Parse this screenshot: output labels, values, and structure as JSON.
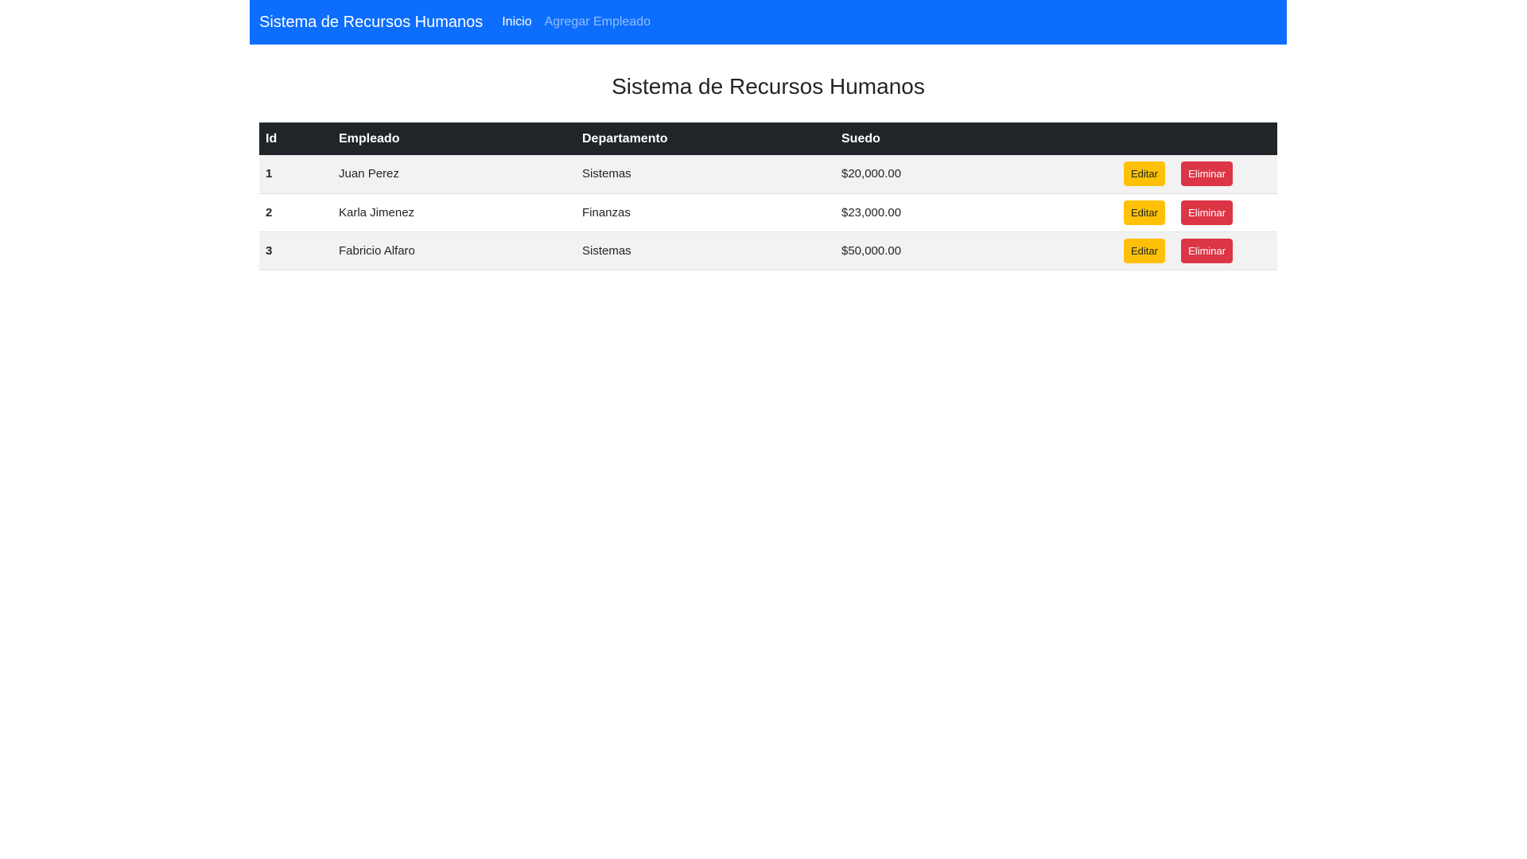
{
  "navbar": {
    "brand": "Sistema de Recursos Humanos",
    "links": [
      {
        "label": "Inicio",
        "active": true
      },
      {
        "label": "Agregar Empleado",
        "active": false
      }
    ],
    "color": "#0d6efd"
  },
  "page": {
    "title": "Sistema de Recursos Humanos"
  },
  "table": {
    "headers": {
      "id": "Id",
      "employee": "Empleado",
      "department": "Departamento",
      "salary": "Suedo",
      "actions": ""
    },
    "rows": [
      {
        "id": "1",
        "employee": "Juan Perez",
        "department": "Sistemas",
        "salary": "$20,000.00",
        "edit_label": "Editar",
        "delete_label": "Eliminar"
      },
      {
        "id": "2",
        "employee": "Karla Jimenez",
        "department": "Finanzas",
        "salary": "$23,000.00",
        "edit_label": "Editar",
        "delete_label": "Eliminar"
      },
      {
        "id": "3",
        "employee": "Fabricio Alfaro",
        "department": "Sistemas",
        "salary": "$50,000.00",
        "edit_label": "Editar",
        "delete_label": "Eliminar"
      }
    ],
    "header_color": "#212529",
    "edit_color": "#ffc107",
    "delete_color": "#dc3545"
  }
}
